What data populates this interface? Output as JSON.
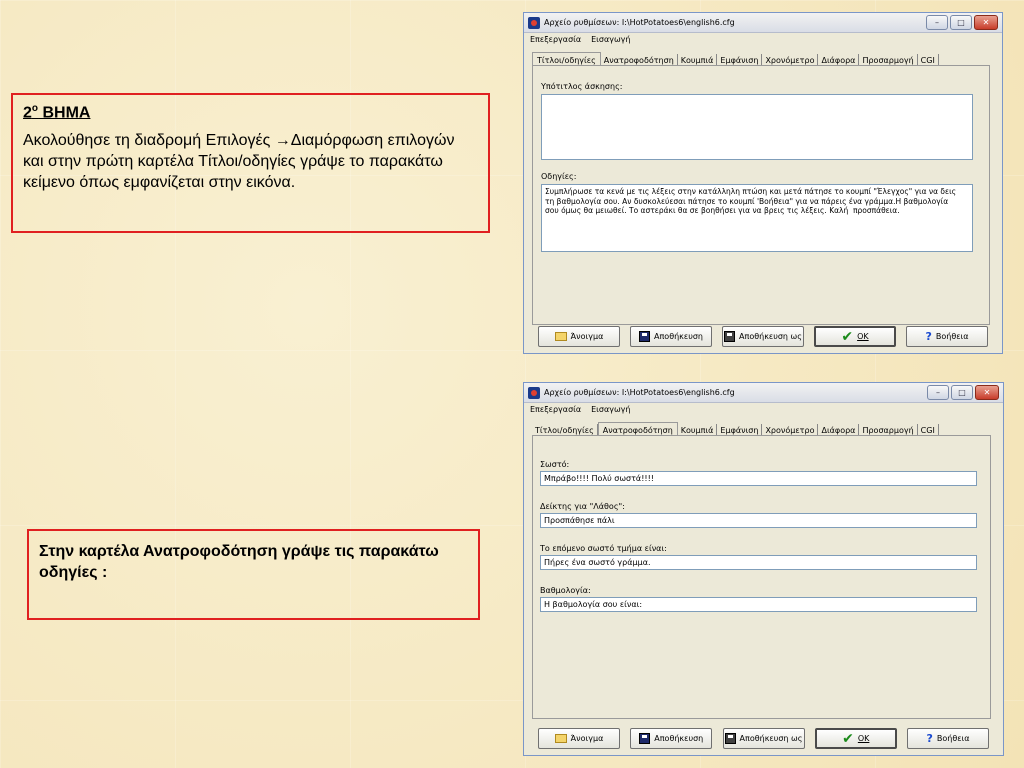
{
  "note1": {
    "title_main": "2",
    "title_sup": "ο",
    "title_rest": " ΒΗΜΑ",
    "body": "Ακολούθησε τη διαδρομή Επιλογές →Διαμόρφωση επιλογών και στην πρώτη καρτέλα Τίτλοι/οδηγίες γράψε το παρακάτω κείμενο  όπως εμφανίζεται στην εικόνα."
  },
  "note2": {
    "body": "Στην καρτέλα Ανατροφοδότηση γράψε τις παρακάτω οδηγίες :"
  },
  "window": {
    "title": "Αρχείο ρυθμίσεων: I:\\HotPotatoes6\\english6.cfg",
    "menu": [
      "Επεξεργασία",
      "Εισαγωγή"
    ],
    "tabs": [
      "Τίτλοι/οδηγίες",
      "Ανατροφοδότηση",
      "Κουμπιά",
      "Εμφάνιση",
      "Χρονόμετρο",
      "Διάφορα",
      "Προσαρμογή",
      "CGI"
    ],
    "buttons": {
      "open": "Άνοιγμα",
      "save": "Αποθήκευση",
      "save_as": "Αποθήκευση ως",
      "ok": "OK",
      "help": "Βοήθεια"
    }
  },
  "win1": {
    "subtitle_label": "Υπότιτλος άσκησης:",
    "subtitle_value": "",
    "instructions_label": "Οδηγίες:",
    "instructions_value": "Συμπλήρωσε τα κενά με τις λέξεις στην κατάλληλη πτώση και μετά πάτησε το κουμπί \"Έλεγχος\" για να δεις τη βαθμολογία σου. Αν δυσκολεύεσαι πάτησε το κουμπί 'Βοήθεια\" για να πάρεις ένα γράμμα.Η βαθμολογία σου όμως θα μειωθεί. Το αστεράκι θα σε βοηθήσει για να βρεις τις λέξεις. Καλή  προσπάθεια."
  },
  "win2": {
    "correct_label": "Σωστό:",
    "correct_value": "Μπράβο!!!! Πολύ σωστά!!!!",
    "wrong_label": "Δείκτης για \"Λάθος\":",
    "wrong_value": "Προσπάθησε πάλι",
    "next_label": "Το επόμενο σωστό τμήμα είναι:",
    "next_value": "Πήρες ένα σωστό γράμμα.",
    "score_label": "Βαθμολογία:",
    "score_value": "Η βαθμολογία σου είναι:"
  }
}
